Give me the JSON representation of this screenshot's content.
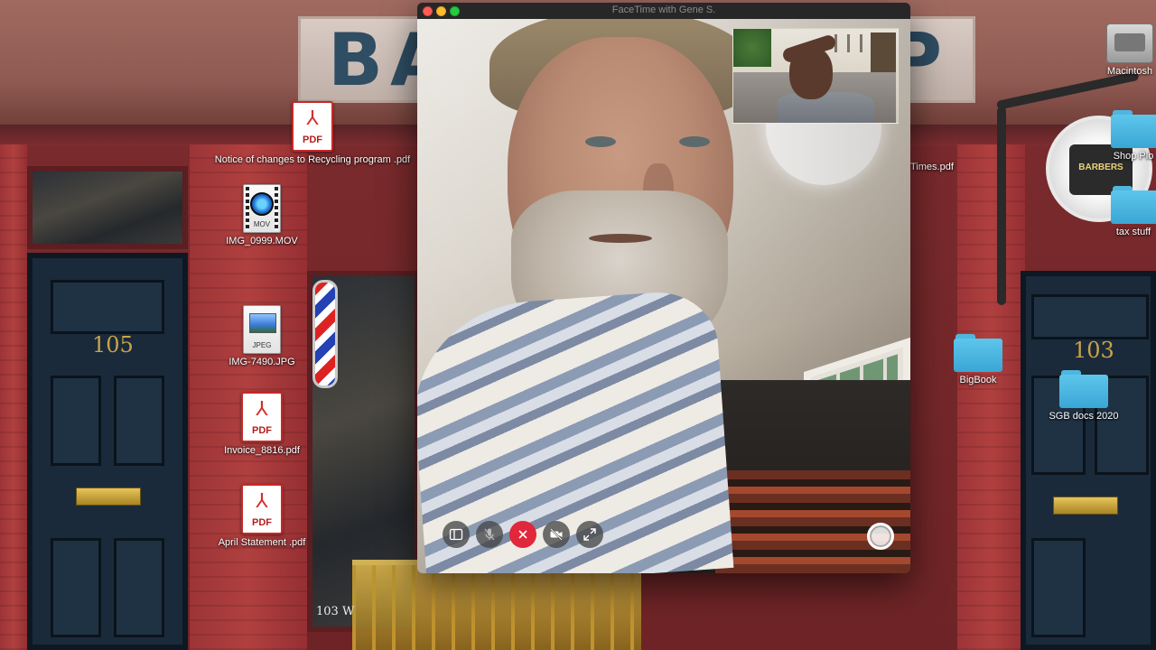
{
  "facetime": {
    "window_title": "FaceTime with Gene S.",
    "controls": {
      "sidebar": "Sidebar",
      "mute": "Mute",
      "end_call": "End",
      "camera_off": "Camera Off",
      "fullscreen": "Full Screen",
      "live_photo": "Live Photo"
    }
  },
  "wallpaper": {
    "sign_left": "BA",
    "sign_right": "P",
    "door_left_number": "105",
    "door_right_number": "103",
    "storefront_text": "103 W",
    "badge_text": "BARBERS"
  },
  "desktop_icons": [
    {
      "label": "Notice of changes to Recycling program .pdf",
      "type": "pdf",
      "tag": "PDF"
    },
    {
      "label": "IMG_0999.MOV",
      "type": "mov",
      "tag": "MOV"
    },
    {
      "label": "IMG-7490.JPG",
      "type": "jpg",
      "tag": "JPEG"
    },
    {
      "label": "Invoice_8816.pdf",
      "type": "pdf",
      "tag": "PDF"
    },
    {
      "label": "April Statement  .pdf",
      "type": "pdf",
      "tag": "PDF"
    },
    {
      "label": "Times.pdf",
      "type": "pdf"
    },
    {
      "label": "Macintosh",
      "type": "drive"
    },
    {
      "label": "Shop Plo",
      "type": "folder"
    },
    {
      "label": "tax stuff",
      "type": "folder"
    },
    {
      "label": "BigBook",
      "type": "folder"
    },
    {
      "label": "SGB docs 2020",
      "type": "folder"
    }
  ],
  "colors": {
    "folder": "#3aa6d4",
    "pdf_accent": "#d32f2f",
    "end_call": "#e0273b"
  }
}
